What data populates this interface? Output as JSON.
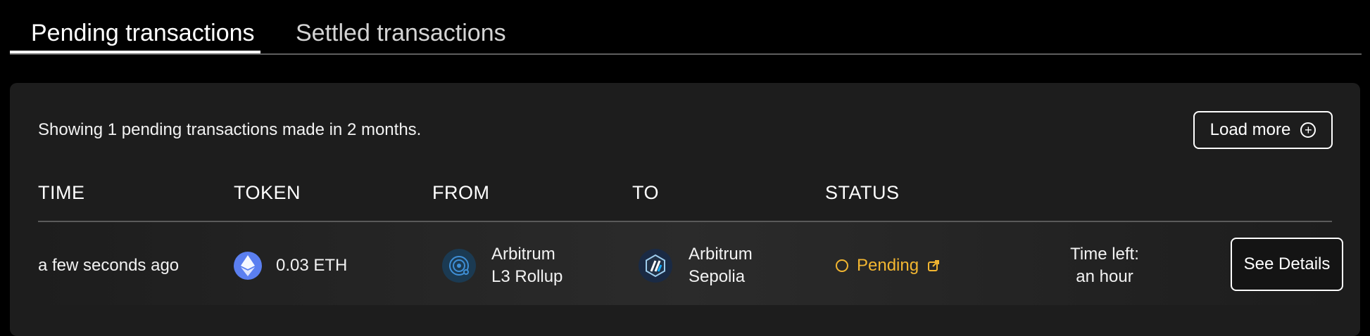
{
  "tabs": [
    {
      "label": "Pending transactions",
      "active": true
    },
    {
      "label": "Settled transactions",
      "active": false
    }
  ],
  "summary": "Showing 1 pending transactions made in 2 months.",
  "load_more": {
    "label": "Load more",
    "icon": "plus-circle-icon"
  },
  "columns": [
    "TIME",
    "TOKEN",
    "FROM",
    "TO",
    "STATUS"
  ],
  "rows": [
    {
      "time": "a few seconds ago",
      "token": {
        "amount": "0.03 ETH",
        "icon": "ethereum-icon"
      },
      "from": {
        "line1": "Arbitrum",
        "line2": "L3 Rollup",
        "icon": "l3-rollup-chain-icon"
      },
      "to": {
        "line1": "Arbitrum",
        "line2": "Sepolia",
        "icon": "arbitrum-icon"
      },
      "status": {
        "label": "Pending",
        "color": "#f2b631"
      },
      "time_left": {
        "line1": "Time left:",
        "line2": "an hour"
      },
      "action": "See Details"
    }
  ],
  "colors": {
    "background": "#000000",
    "panel": "#1d1d1d",
    "text": "#ffffff",
    "pending": "#f2b631",
    "ethereum": "#5b7ff0"
  }
}
